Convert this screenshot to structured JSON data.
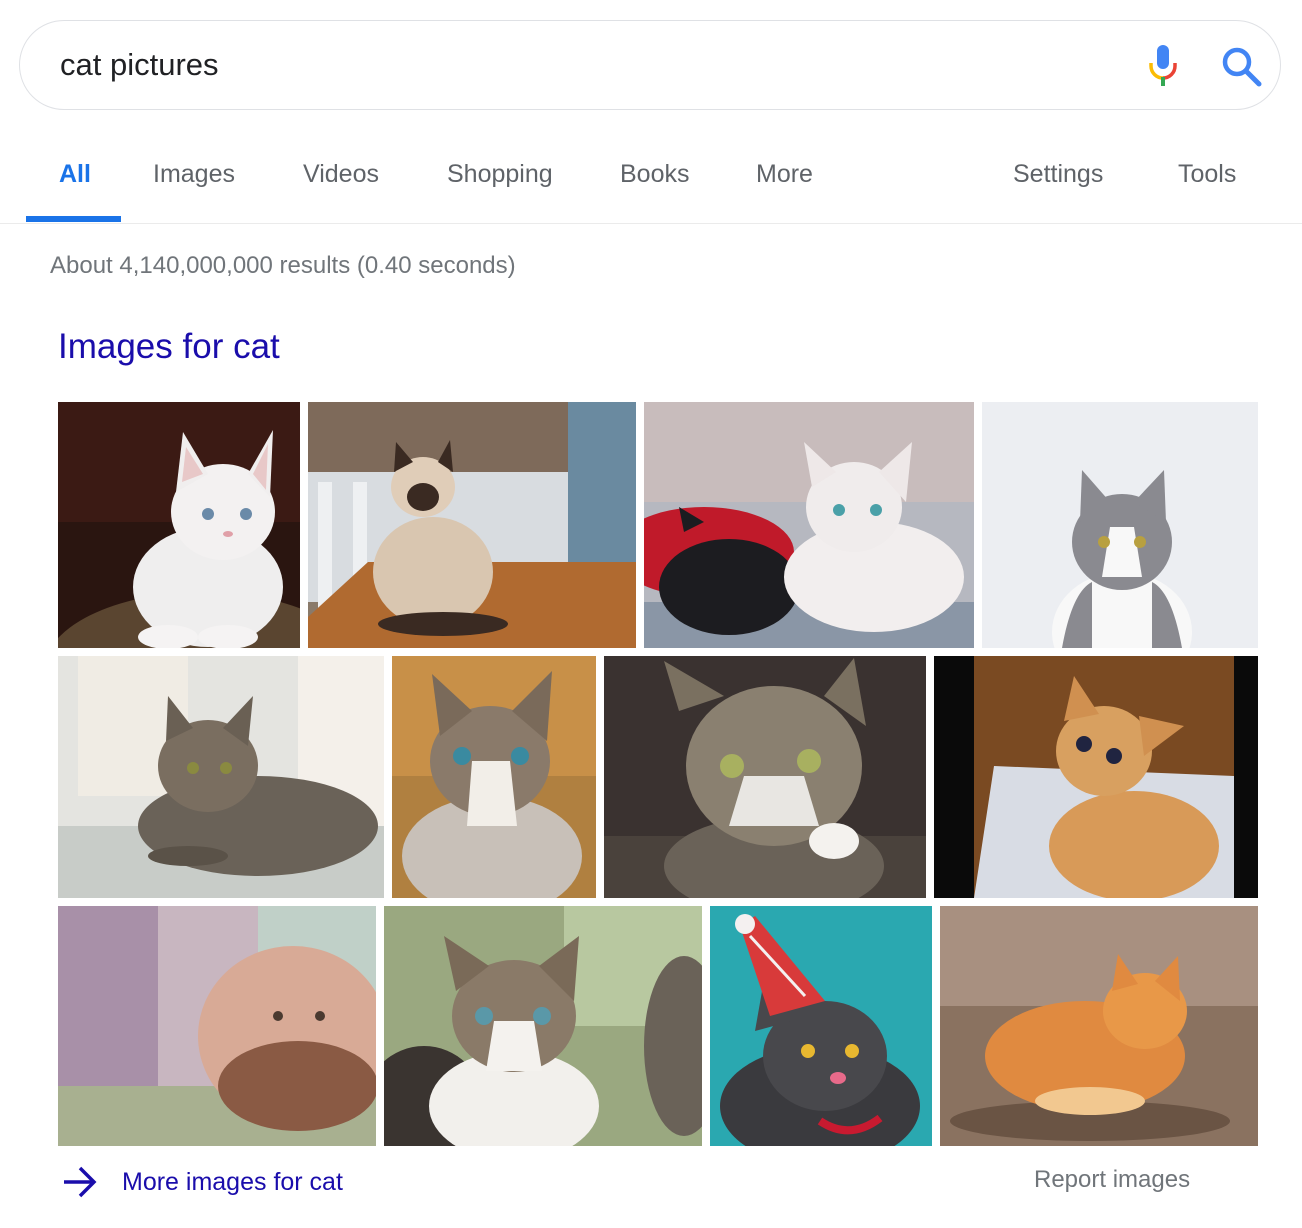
{
  "search": {
    "query": "cat pictures",
    "mic_icon": "microphone-icon",
    "search_icon": "magnifier-icon"
  },
  "tabs": [
    {
      "label": "All",
      "active": true
    },
    {
      "label": "Images",
      "active": false
    },
    {
      "label": "Videos",
      "active": false
    },
    {
      "label": "Shopping",
      "active": false
    },
    {
      "label": "Books",
      "active": false
    },
    {
      "label": "More",
      "active": false
    }
  ],
  "tools_tabs": [
    {
      "label": "Settings"
    },
    {
      "label": "Tools"
    }
  ],
  "result_stats": "About 4,140,000,000 results (0.40 seconds)",
  "image_pack": {
    "title": "Images for cat",
    "more_label": "More images for cat",
    "report_label": "Report images",
    "images": [
      {
        "subject": "white kitten on leopard-print cushion"
      },
      {
        "subject": "siamese cat on wooden table"
      },
      {
        "subject": "white kitten and black kitten on red blanket"
      },
      {
        "subject": "gray and white cat on white background"
      },
      {
        "subject": "tabby cat lying on sofa"
      },
      {
        "subject": "blue-eyed kitten"
      },
      {
        "subject": "tabby cat with green eyes close-up"
      },
      {
        "subject": "orange kitten on pillow"
      },
      {
        "subject": "fluffy cream cat jumping"
      },
      {
        "subject": "tabby and white kittens"
      },
      {
        "subject": "gray cat wearing striped party hat"
      },
      {
        "subject": "orange tabby cat lying on wood floor"
      }
    ]
  },
  "colors": {
    "active_tab": "#1a73e8",
    "link": "#1a0dab",
    "muted": "#70757a"
  }
}
